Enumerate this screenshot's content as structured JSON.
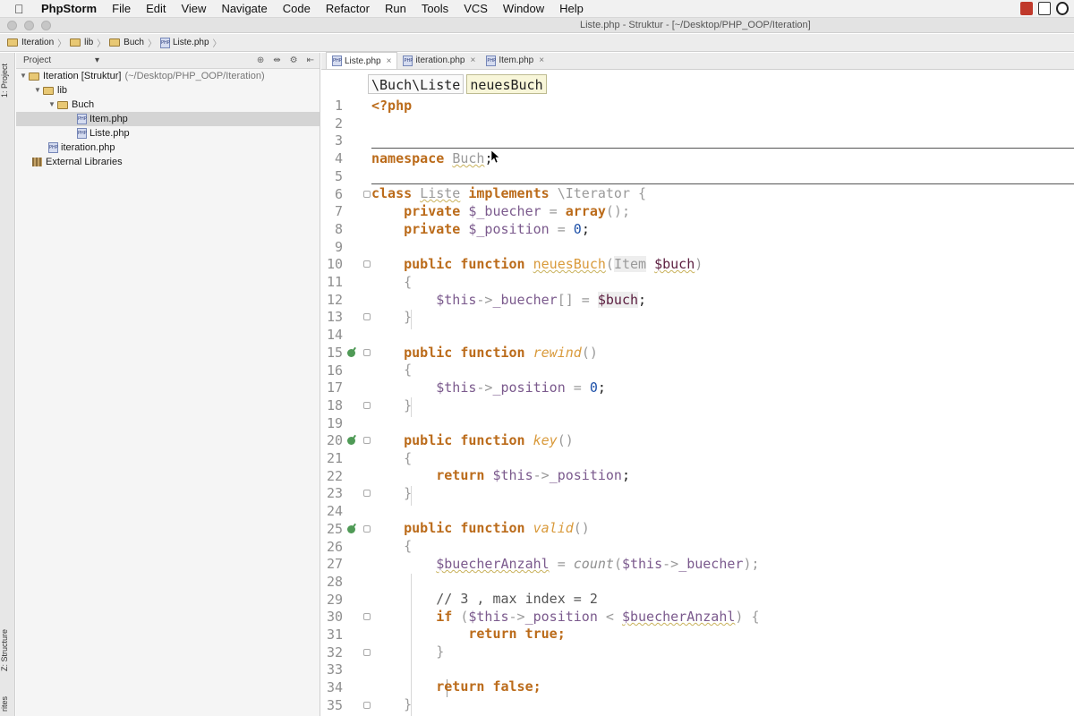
{
  "menubar": {
    "items": [
      "PhpStorm",
      "File",
      "Edit",
      "View",
      "Navigate",
      "Code",
      "Refactor",
      "Run",
      "Tools",
      "VCS",
      "Window",
      "Help"
    ]
  },
  "window": {
    "title": "Liste.php - Struktur - [~/Desktop/PHP_OOP/Iteration]"
  },
  "navbar": {
    "crumbs": [
      "Iteration",
      "lib",
      "Buch",
      "Liste.php"
    ]
  },
  "leftstrip": {
    "tab_project": "1: Project",
    "tab_structure": "Z: Structure",
    "tab_favorites": "rites"
  },
  "project_panel": {
    "dropdown": "Project",
    "tree": {
      "root_label": "Iteration [Struktur]",
      "root_path": "(~/Desktop/PHP_OOP/Iteration)",
      "lib": "lib",
      "buch": "Buch",
      "item": "Item.php",
      "liste": "Liste.php",
      "iteration": "iteration.php",
      "external": "External Libraries"
    }
  },
  "editor": {
    "tabs": [
      {
        "label": "Liste.php",
        "active": true
      },
      {
        "label": "iteration.php",
        "active": false
      },
      {
        "label": "Item.php",
        "active": false
      }
    ],
    "tab_close": "×",
    "code_crumbs": [
      "\\Buch\\Liste",
      "neuesBuch"
    ],
    "line_numbers": [
      "1",
      "2",
      "3",
      "4",
      "5",
      "6",
      "7",
      "8",
      "9",
      "10",
      "11",
      "12",
      "13",
      "14",
      "15",
      "16",
      "17",
      "18",
      "19",
      "20",
      "21",
      "22",
      "23",
      "24",
      "25",
      "26",
      "27",
      "28",
      "29",
      "30",
      "31",
      "32",
      "33",
      "34",
      "35"
    ],
    "code": {
      "l1": "<?php",
      "l4_kw": "namespace",
      "l4_name": "Buch",
      "l4_semi": ";",
      "l6_class": "class",
      "l6_name": "Liste",
      "l6_impl": "implements",
      "l6_iface": "\\Iterator {",
      "l7_priv": "private",
      "l7_var": "$_buecher",
      "l7_eq": " = ",
      "l7_array": "array",
      "l7_rest": "();",
      "l8_priv": "private",
      "l8_var": "$_position",
      "l8_eq": " = ",
      "l8_num": "0",
      "l8_semi": ";",
      "l10_pf": "public function",
      "l10_fn": "neuesBuch",
      "l10_open": "(",
      "l10_type": "Item",
      "l10_param": "$buch",
      "l10_close": ")",
      "brace_open": "{",
      "brace_close": "}",
      "l12_this": "$this",
      "l12_arrow": "->",
      "l12_prop": "_buecher",
      "l12_idx": "[]",
      "l12_eq": " = ",
      "l12_val": "$buch",
      "l12_semi": ";",
      "l15_pf": "public function",
      "l15_fn": "rewind",
      "parens": "()",
      "l17_this": "$this",
      "l17_arrow": "->",
      "l17_prop": "_position",
      "l17_eq": " = ",
      "l17_num": "0",
      "l17_semi": ";",
      "l20_pf": "public function",
      "l20_fn": "key",
      "l22_ret": "return",
      "l22_this": "$this",
      "l22_arrow": "->",
      "l22_prop": "_position",
      "l22_semi": ";",
      "l25_pf": "public function",
      "l25_fn": "valid",
      "l27_var": "$buecherAnzahl",
      "l27_eq": " = ",
      "l27_fn": "count",
      "l27_open": "(",
      "l27_this": "$this",
      "l27_arrow": "->",
      "l27_prop": "_buecher",
      "l27_close": ");",
      "l29_cmt": "// 3 , max index = 2",
      "l30_if": "if",
      "l30_open": " (",
      "l30_this": "$this",
      "l30_arrow": "->",
      "l30_prop": "_position",
      "l30_lt": " < ",
      "l30_var": "$buecherAnzahl",
      "l30_close": ") {",
      "l31_ret": "return true;",
      "l34_ret": "return false;"
    }
  },
  "colors": {
    "keyword": "#bb6b1a",
    "variable": "#7b5a8d",
    "number": "#1d50a8",
    "function": "#d99a3b",
    "implements_marker": "#4f9a56"
  }
}
